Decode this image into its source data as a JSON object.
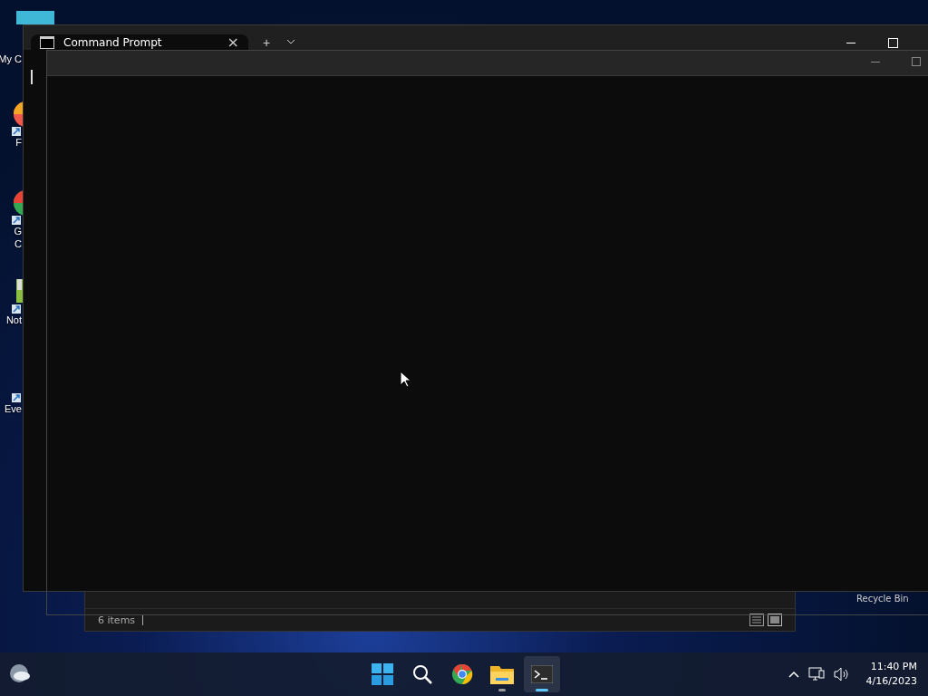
{
  "desktop_icons": [
    {
      "kind": "computer",
      "label": "My C"
    },
    {
      "kind": "browser-red",
      "label": "F"
    },
    {
      "kind": "browser-green",
      "label": "G",
      "label_2": "C"
    },
    {
      "kind": "notepad",
      "label": "Not"
    },
    {
      "kind": "shortcut",
      "label": "Eve"
    }
  ],
  "recycle_bin": {
    "label": "Recycle Bin"
  },
  "explorer": {
    "status": "6 items"
  },
  "terminal": {
    "tab_title": "Command Prompt",
    "close": "×",
    "new_tab": "+"
  },
  "taskbar": {
    "apps": [
      {
        "kind": "start",
        "running": false,
        "selected": false
      },
      {
        "kind": "search",
        "running": false,
        "selected": false
      },
      {
        "kind": "chrome",
        "running": false,
        "selected": false
      },
      {
        "kind": "folder",
        "running": true,
        "selected": false
      },
      {
        "kind": "terminal",
        "running": true,
        "selected": true
      }
    ],
    "time": "11:40 PM",
    "date": "4/16/2023"
  }
}
